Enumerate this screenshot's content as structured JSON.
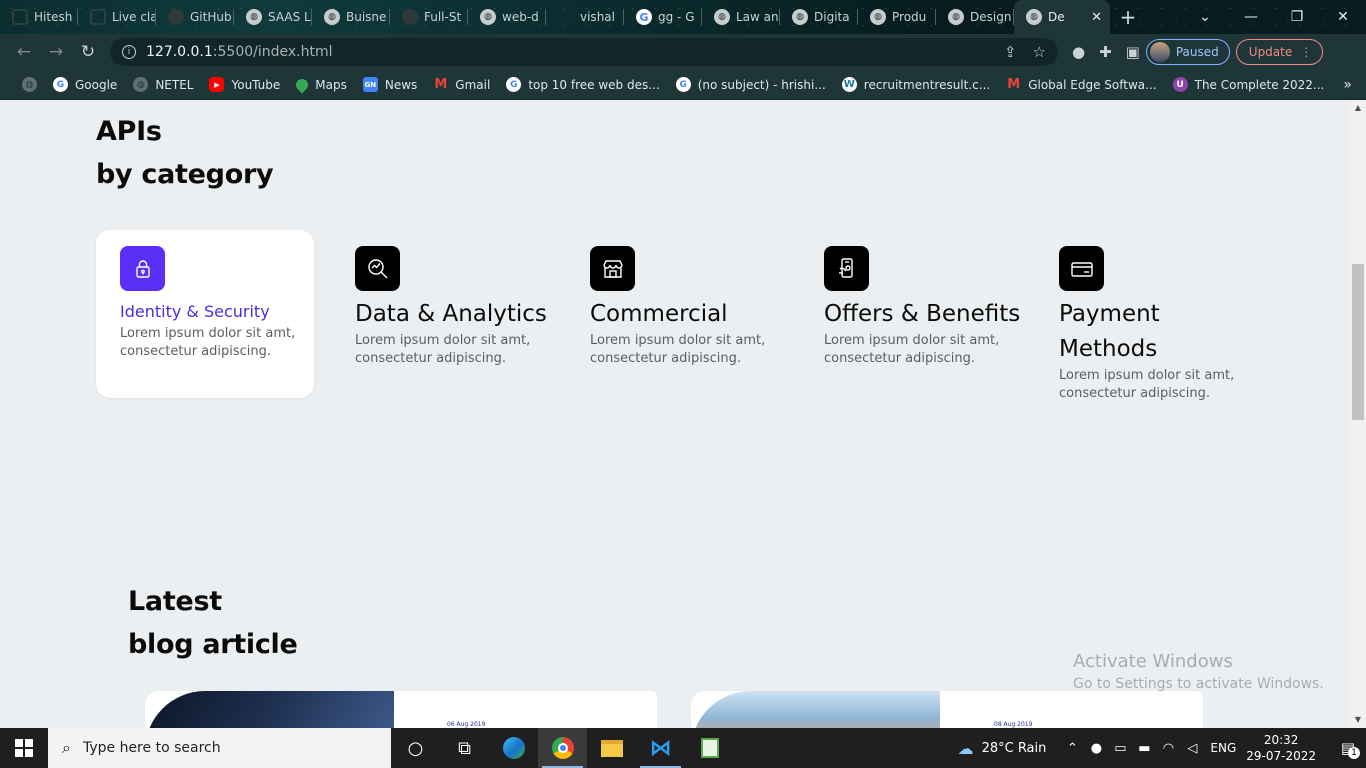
{
  "browser": {
    "tabs": [
      {
        "title": "Hitesh",
        "favicon": "square-icon"
      },
      {
        "title": "Live cla",
        "favicon": "square-icon"
      },
      {
        "title": "GitHub",
        "favicon": "github-icon"
      },
      {
        "title": "SAAS L",
        "favicon": "globe-icon"
      },
      {
        "title": "Buisne",
        "favicon": "globe-icon"
      },
      {
        "title": "Full-St",
        "favicon": "github-icon"
      },
      {
        "title": "web-d",
        "favicon": "globe-icon"
      },
      {
        "title": "vishal",
        "favicon": "none"
      },
      {
        "title": "gg - G",
        "favicon": "google-icon"
      },
      {
        "title": "Law an",
        "favicon": "globe-icon"
      },
      {
        "title": "Digita",
        "favicon": "globe-icon"
      },
      {
        "title": "Produ",
        "favicon": "globe-icon"
      },
      {
        "title": "Design",
        "favicon": "globe-icon"
      },
      {
        "title": "De",
        "favicon": "globe-icon",
        "active": true
      }
    ],
    "new_tab": "+",
    "window_controls": {
      "chevron": "⌄",
      "minimize": "—",
      "restore": "❐",
      "close": "✕"
    },
    "url_host": "127.0.0.1",
    "url_path": ":5500/index.html",
    "profile_status": "Paused",
    "update_label": "Update",
    "bookmarks": [
      {
        "label": "Google",
        "icon": "google-icon"
      },
      {
        "label": "NETEL",
        "icon": "globe-icon"
      },
      {
        "label": "YouTube",
        "icon": "youtube-icon"
      },
      {
        "label": "Maps",
        "icon": "maps-icon"
      },
      {
        "label": "News",
        "icon": "news-icon"
      },
      {
        "label": "Gmail",
        "icon": "gmail-icon"
      },
      {
        "label": "top 10 free web des...",
        "icon": "google-icon"
      },
      {
        "label": "(no subject) - hrishi...",
        "icon": "google-icon"
      },
      {
        "label": "recruitmentresult.c...",
        "icon": "wordpress-icon"
      },
      {
        "label": "Global Edge Softwa...",
        "icon": "gmail-icon"
      },
      {
        "label": "The Complete 2022...",
        "icon": "u-icon"
      }
    ],
    "bookmarks_more": "»"
  },
  "page": {
    "apis_title_line1": "APIs",
    "apis_title_line2": "by category",
    "categories": [
      {
        "name": "Identity & Security",
        "icon": "lock-icon",
        "desc": "Lorem ipsum dolor sit amt, consectetur adipiscing.",
        "selected": true
      },
      {
        "name": "Data & Analytics",
        "icon": "analytics-search-icon",
        "desc": "Lorem ipsum dolor sit amt, consectetur adipiscing."
      },
      {
        "name": "Commercial",
        "icon": "store-icon",
        "desc": "Lorem ipsum dolor sit amt, consectetur adipiscing."
      },
      {
        "name": "Offers & Benefits",
        "icon": "offers-phone-icon",
        "desc": "Lorem ipsum dolor sit amt, consectetur adipiscing."
      },
      {
        "name": "Payment Methods",
        "icon": "credit-card-icon",
        "desc": "Lorem ipsum dolor sit amt, consectetur adipiscing."
      }
    ],
    "blog_title_line1": "Latest",
    "blog_title_line2": "blog article",
    "blog_cards": [
      {
        "date": "06 Aug 2019"
      },
      {
        "date": "08 Aug 2019"
      }
    ],
    "accent_color": "#5b2ef7"
  },
  "watermark": {
    "line1": "Activate Windows",
    "line2": "Go to Settings to activate Windows."
  },
  "taskbar": {
    "search_placeholder": "Type here to search",
    "weather": "28°C  Rain",
    "language": "ENG",
    "time": "20:32",
    "date": "29-07-2022",
    "notification_count": "1"
  }
}
